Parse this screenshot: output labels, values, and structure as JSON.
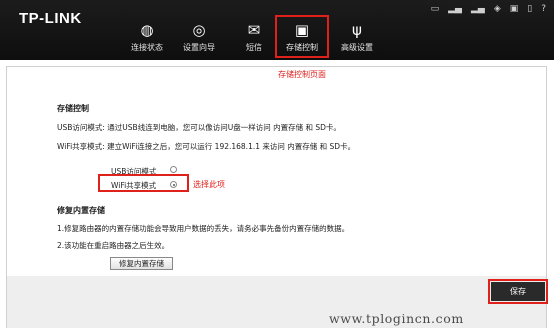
{
  "brand": "TP-LINK",
  "status_icons": [
    "message-icon",
    "signal-icon",
    "signal-icon",
    "wifi-icon",
    "storage-icon",
    "battery-icon",
    "help-icon"
  ],
  "nav": [
    {
      "label": "连接状态",
      "icon": "globe-icon",
      "glyph": "◍"
    },
    {
      "label": "设置向导",
      "icon": "wizard-icon",
      "glyph": "◎"
    },
    {
      "label": "短信",
      "icon": "sms-icon",
      "glyph": "✉"
    },
    {
      "label": "存储控制",
      "icon": "sdcard-icon",
      "glyph": "▣",
      "active": true
    },
    {
      "label": "高级设置",
      "icon": "tools-icon",
      "glyph": "ψ"
    }
  ],
  "annotations": {
    "storage_page": "存储控制页面",
    "select_option": "选择此项"
  },
  "storage": {
    "heading": "存储控制",
    "usb_desc": "USB访问模式: 通过USB线连到电脑，您可以像访问U盘一样访问 内置存储 和 SD卡。",
    "wifi_desc": "WiFi共享模式: 建立WiFi连接之后，您可以运行   192.168.1.1 来访问 内置存储 和 SD卡。",
    "usb_mode": "USB访问模式",
    "wifi_mode": "WiFi共享模式",
    "selected_mode": "WiFi共享模式"
  },
  "restore": {
    "heading": "修复内置存储",
    "note1": "1.修复路由器的内置存储功能会导致用户数据的丢失，请务必事先备份内置存储的数据。",
    "note2": "2.该功能在重启路由器之后生效。",
    "button": "修复内置存储"
  },
  "save_button": "保存",
  "watermark": "www.tplogincn.com",
  "colors": {
    "highlight": "#e0201b",
    "topbar": "#141414",
    "save_button": "#2a2a2a"
  }
}
